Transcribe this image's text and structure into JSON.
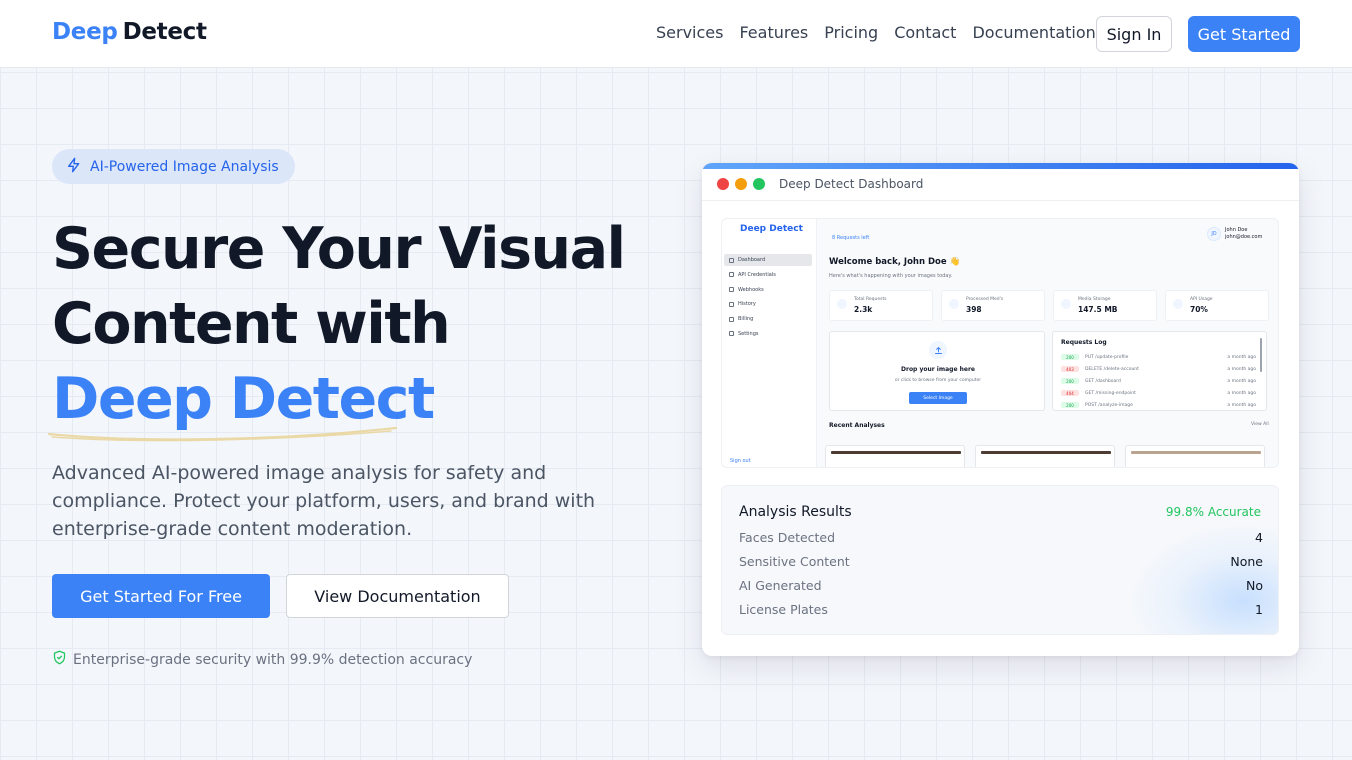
{
  "nav": {
    "logo_part1": "Deep",
    "logo_part2": "Detect",
    "links": [
      "Services",
      "Features",
      "Pricing",
      "Contact",
      "Documentation"
    ],
    "sign_in": "Sign In",
    "get_started": "Get Started"
  },
  "hero": {
    "badge": "AI-Powered Image Analysis",
    "title_line1": "Secure Your Visual",
    "title_line2": "Content with",
    "title_line3": "Deep Detect",
    "description": "Advanced AI-powered image analysis for safety and compliance. Protect your platform, users, and brand with enterprise-grade content moderation.",
    "cta_primary": "Get Started For Free",
    "cta_secondary": "View Documentation",
    "security_note": "Enterprise-grade security with 99.9% detection accuracy"
  },
  "window": {
    "title": "Deep Detect Dashboard",
    "dot_colors": [
      "#ef4444",
      "#f59e0b",
      "#22c55e"
    ],
    "dashboard": {
      "logo": "Deep Detect",
      "nav": [
        "Dashboard",
        "API Credentials",
        "Webhooks",
        "History",
        "Billing",
        "Settings"
      ],
      "sign_out": "Sign out",
      "requests_left": "8 Requests left",
      "user_initials": "JD",
      "user_name": "John Doe",
      "user_email": "john@doe.com",
      "welcome": "Welcome back, John Doe 👋",
      "welcome_sub": "Here's what's happening with your images today.",
      "stats": [
        {
          "label": "Total Requests",
          "value": "2.3k"
        },
        {
          "label": "Processed Med's",
          "value": "398"
        },
        {
          "label": "Media Storage",
          "value": "147.5 MB"
        },
        {
          "label": "API Usage",
          "value": "70%"
        }
      ],
      "drop_title": "Drop your image here",
      "drop_sub": "or click to browse from your computer",
      "select_button": "Select Image",
      "log_title": "Requests Log",
      "log": [
        {
          "code": "200",
          "text": "PUT /update-profile",
          "time": "a month ago"
        },
        {
          "code": "403",
          "text": "DELETE /delete-account",
          "time": "a month ago"
        },
        {
          "code": "200",
          "text": "GET /dashboard",
          "time": "a month ago"
        },
        {
          "code": "404",
          "text": "GET /missing-endpoint",
          "time": "a month ago"
        },
        {
          "code": "200",
          "text": "POST /analyze-image",
          "time": "a month ago"
        }
      ],
      "recent_title": "Recent Analyses",
      "view_all": "View All"
    }
  },
  "results": {
    "title": "Analysis Results",
    "accuracy": "99.8% Accurate",
    "rows": [
      {
        "label": "Faces Detected",
        "value": "4"
      },
      {
        "label": "Sensitive Content",
        "value": "None"
      },
      {
        "label": "AI Generated",
        "value": "No"
      },
      {
        "label": "License Plates",
        "value": "1"
      }
    ]
  },
  "colors": {
    "primary": "#3b82f6",
    "success": "#22c55e",
    "text": "#111827"
  }
}
